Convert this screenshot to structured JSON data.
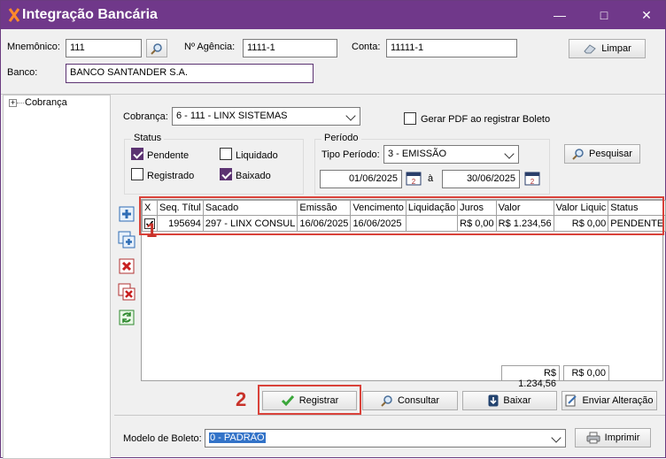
{
  "window": {
    "title": "Integração Bancária",
    "title_color": "#70388a",
    "minimize": "—",
    "maximize": "□",
    "close": "✕"
  },
  "header": {
    "mnemonico_label": "Mnemônico:",
    "mnemonico_value": "111",
    "agencia_label": "Nº Agência:",
    "agencia_value": "1111-1",
    "conta_label": "Conta:",
    "conta_value": "11111-1",
    "limpar_label": "Limpar",
    "banco_label": "Banco:",
    "banco_value": "BANCO SANTANDER S.A."
  },
  "tree": {
    "items": [
      {
        "label": "Cobrança",
        "icon": "plus-expander"
      }
    ]
  },
  "filters": {
    "cobranca_label": "Cobrança:",
    "cobranca_value": "6 - 111 - LINX SISTEMAS",
    "gerar_pdf_label": "Gerar PDF ao registrar Boleto",
    "gerar_pdf_checked": false,
    "status_title": "Status",
    "status": {
      "pendente": {
        "label": "Pendente",
        "checked": true
      },
      "liquidado": {
        "label": "Liquidado",
        "checked": false
      },
      "registrado": {
        "label": "Registrado",
        "checked": false
      },
      "baixado": {
        "label": "Baixado",
        "checked": true
      }
    },
    "periodo_title": "Período",
    "tipo_periodo_label": "Tipo Período:",
    "tipo_periodo_value": "3 - EMISSÃO",
    "date_from": "01/06/2025",
    "date_sep": "à",
    "date_to": "30/06/2025",
    "pesquisar_label": "Pesquisar"
  },
  "grid": {
    "columns": [
      "X",
      "Seq. Títul",
      "Sacado",
      "Emissão",
      "Vencimento",
      "Liquidação",
      "Juros",
      "Valor",
      "Valor Liquic",
      "Status"
    ],
    "rows": [
      {
        "checked": true,
        "seq": "195694",
        "sacado": "297 - LINX CONSUL",
        "emissao": "16/06/2025",
        "vencimento": "16/06/2025",
        "liquidacao": "",
        "juros": "R$ 0,00",
        "valor": "R$ 1.234,56",
        "valor_liquido": "R$ 0,00",
        "status": "PENDENTE"
      }
    ],
    "total_valor": "R$ 1.234,56",
    "total_liquido": "R$ 0,00"
  },
  "annotations": {
    "marker_1": "1",
    "marker_2": "2",
    "marker_color": "#d9423a"
  },
  "actions": {
    "registrar": "Registrar",
    "consultar": "Consultar",
    "baixar": "Baixar",
    "enviar_alteracao": "Enviar Alteração"
  },
  "footer": {
    "modelo_label": "Modelo de Boleto:",
    "modelo_value": "0 - PADRÃO",
    "imprimir_label": "Imprimir"
  }
}
